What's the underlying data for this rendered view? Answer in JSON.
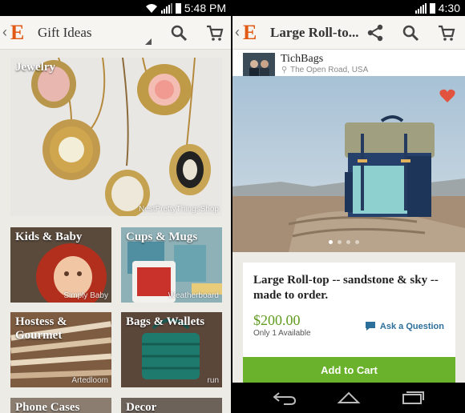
{
  "left_screen": {
    "status": {
      "time": "5:48 PM"
    },
    "actionbar": {
      "back": "‹",
      "logo": "E",
      "title": "Gift Ideas"
    },
    "categories": [
      {
        "label": "Jewelry",
        "credit": "NestPrettyThingsShop"
      },
      {
        "label": "Kids & Baby",
        "credit": "Simply Baby"
      },
      {
        "label": "Cups & Mugs",
        "credit": "Weatherboard"
      },
      {
        "label": "Hostess & Gourmet",
        "credit": "Artedloom"
      },
      {
        "label": "Bags & Wallets",
        "credit": "run"
      },
      {
        "label": "Phone Cases",
        "credit": ""
      },
      {
        "label": "Decor",
        "credit": ""
      }
    ]
  },
  "right_screen": {
    "status": {
      "time": "4:30"
    },
    "actionbar": {
      "back": "‹",
      "logo": "E",
      "title": "Large Roll-to..."
    },
    "shop": {
      "name": "TichBags",
      "location": "The Open Road, USA"
    },
    "listing": {
      "title": "Large Roll-top -- sandstone & sky -- made to order.",
      "price": "$200.00",
      "availability": "Only 1 Available",
      "ask_label": "Ask a Question",
      "add_to_cart_label": "Add to Cart",
      "image_count": 4,
      "current_image": 1
    }
  },
  "colors": {
    "etsy_orange": "#e05a16",
    "price_green": "#5f9c1f",
    "cart_green": "#6ab22c",
    "link_blue": "#2d6f9b",
    "favorite_red": "#e2533f"
  }
}
